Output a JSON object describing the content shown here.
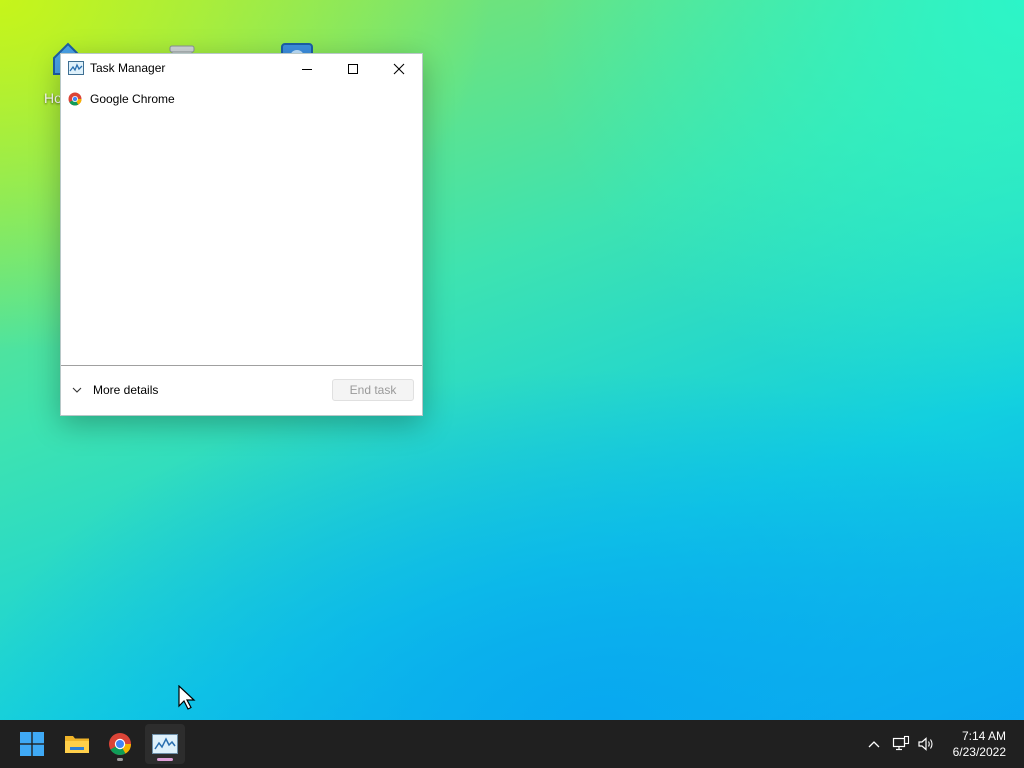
{
  "desktop": {
    "icons": [
      {
        "name": "home-icon",
        "label": "Ho"
      },
      {
        "name": "recycle-bin-icon",
        "label": ""
      },
      {
        "name": "shortcut-icon",
        "label": ""
      }
    ]
  },
  "window": {
    "title": "Task Manager",
    "processes": [
      {
        "name": "Google Chrome",
        "icon": "chrome-icon"
      }
    ],
    "footer": {
      "more_details": "More details",
      "end_task": "End task"
    }
  },
  "taskbar": {
    "apps": [
      {
        "name": "start",
        "icon": "windows-logo-icon"
      },
      {
        "name": "file-explorer",
        "icon": "folder-icon"
      },
      {
        "name": "chrome",
        "icon": "chrome-icon",
        "running": true
      },
      {
        "name": "task-manager",
        "icon": "task-manager-icon",
        "running": true,
        "active": true
      }
    ],
    "tray": {
      "icons": [
        "chevron-up-icon",
        "network-icon",
        "volume-icon"
      ],
      "time": "7:14 AM",
      "date": "6/23/2022"
    }
  },
  "colors": {
    "taskbar_bg": "#202020",
    "window_bg": "#ffffff",
    "running_indicator": "#9a9a9a",
    "active_indicator": "#e0a0d8"
  }
}
